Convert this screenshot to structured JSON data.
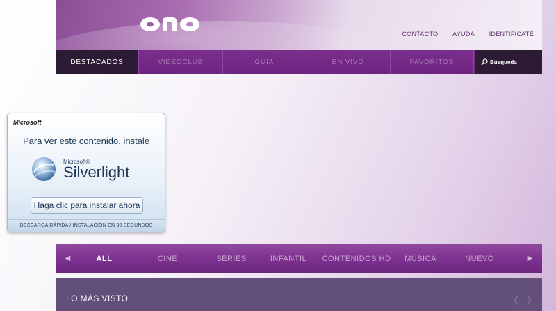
{
  "header": {
    "logo": "ono",
    "links": [
      "CONTACTO",
      "AYUDA",
      "IDENTIFICATE"
    ]
  },
  "topnav": {
    "items": [
      "DESTACADOS",
      "VIDEOCLUB",
      "GUÍA",
      "EN VIVO",
      "FAVORITOS"
    ],
    "active_index": 0,
    "search_label": "Búsqueda"
  },
  "silverlight": {
    "company": "Microsoft",
    "message": "Para ver este contenido, instale",
    "brand_company": "Microsoft®",
    "brand_name": "Silverlight",
    "button_label": "Haga clic para instalar ahora",
    "footer": "DESCARGA RÁPIDA / INSTALACIÓN EN 30 SEGUNDOS"
  },
  "categories": {
    "items": [
      "ALL",
      "CINE",
      "SERIES",
      "INFANTIL",
      "CONTENIDOS HD",
      "MÚSICA",
      "NUEVO"
    ],
    "active_index": 0
  },
  "most_viewed": {
    "title": "LO MÁS VISTO"
  },
  "colors": {
    "nav_purple": "#7b2f8c",
    "nav_active": "#2d1a35",
    "section_bar": "#63507a"
  }
}
